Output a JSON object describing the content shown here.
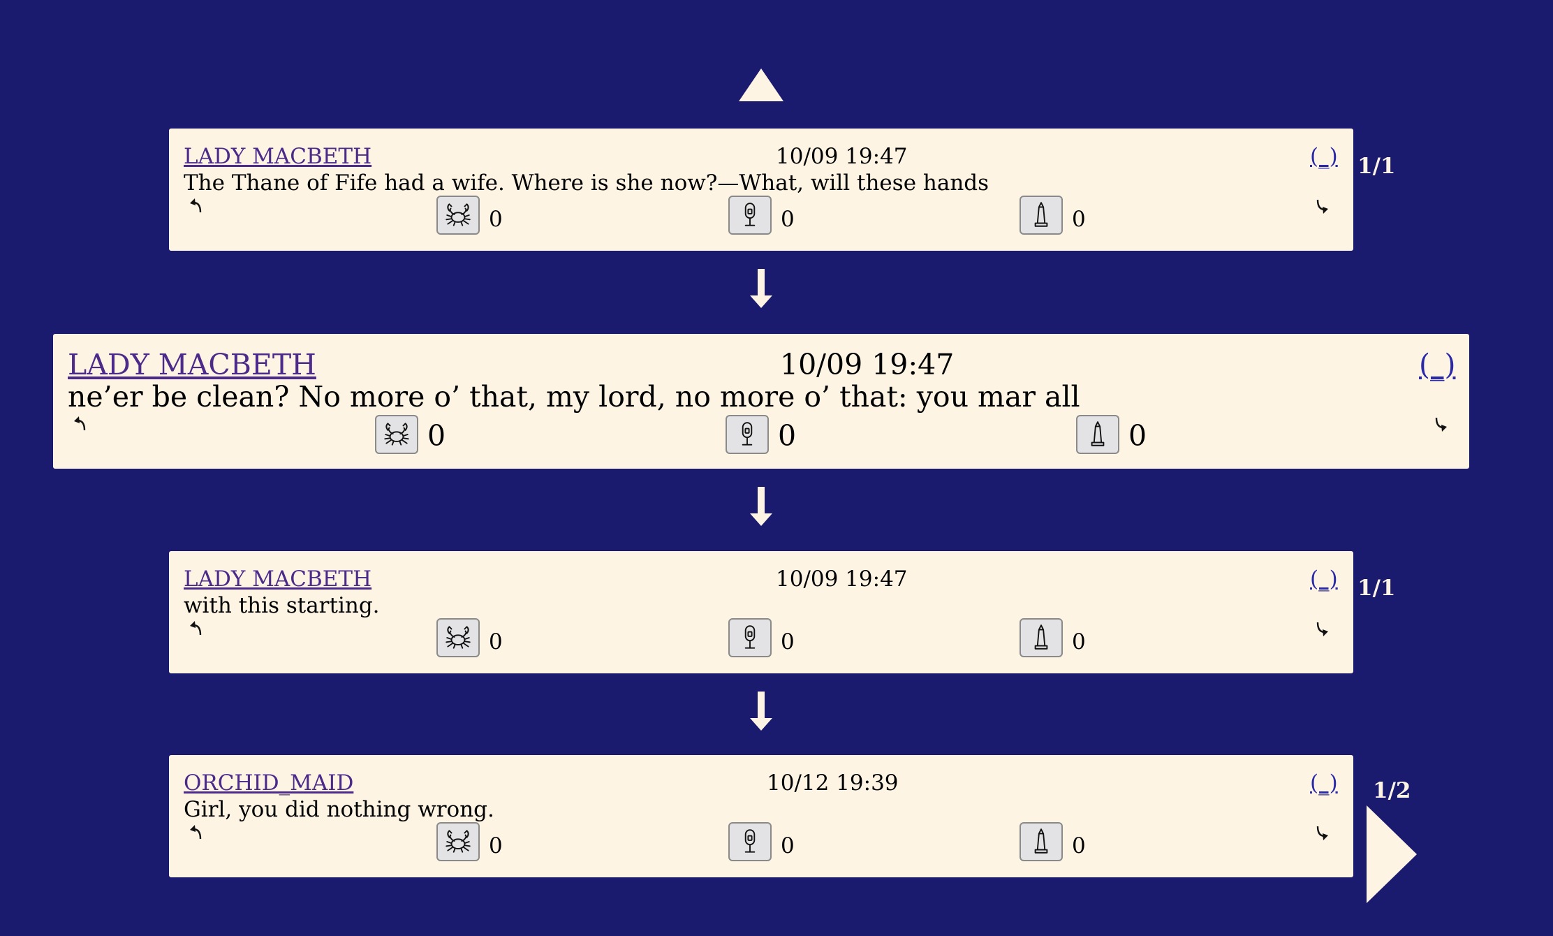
{
  "posts": [
    {
      "author": "LADY MACBETH",
      "time": "10/09 19:47",
      "collapse_label": "(_)",
      "text": "The Thane of Fife had a wife. Where is she now?—What, will these hands",
      "reactions": [
        {
          "icon": "crab-icon",
          "count": "0"
        },
        {
          "icon": "microphone-icon",
          "count": "0"
        },
        {
          "icon": "obelisk-icon",
          "count": "0"
        }
      ],
      "counter": "1/1"
    },
    {
      "author": "LADY MACBETH",
      "time": "10/09 19:47",
      "collapse_label": "(_)",
      "text": "ne’er be clean? No more o’ that, my lord, no more o’ that: you mar all",
      "reactions": [
        {
          "icon": "crab-icon",
          "count": "0"
        },
        {
          "icon": "microphone-icon",
          "count": "0"
        },
        {
          "icon": "obelisk-icon",
          "count": "0"
        }
      ]
    },
    {
      "author": "LADY MACBETH",
      "time": "10/09 19:47",
      "collapse_label": "(_)",
      "text": "with this starting.",
      "reactions": [
        {
          "icon": "crab-icon",
          "count": "0"
        },
        {
          "icon": "microphone-icon",
          "count": "0"
        },
        {
          "icon": "obelisk-icon",
          "count": "0"
        }
      ],
      "counter": "1/1"
    },
    {
      "author": "ORCHID_MAID",
      "time": "10/12 19:39",
      "collapse_label": "(_)",
      "text": "Girl, you did nothing wrong.",
      "reactions": [
        {
          "icon": "crab-icon",
          "count": "0"
        },
        {
          "icon": "microphone-icon",
          "count": "0"
        },
        {
          "icon": "obelisk-icon",
          "count": "0"
        }
      ],
      "counter": "1/2"
    }
  ],
  "colors": {
    "background": "#1a1a6e",
    "card": "#fdf4e3",
    "author_link": "#4b2a8a",
    "collapse_link": "#2a2aa8"
  }
}
